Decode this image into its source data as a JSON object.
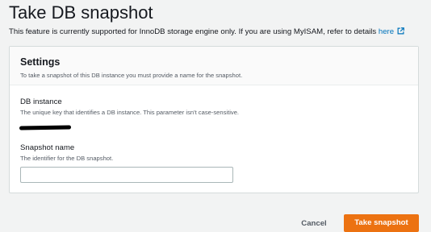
{
  "page": {
    "title": "Take DB snapshot",
    "intro_text": "This feature is currently supported for InnoDB storage engine only. If you are using MyISAM, refer to details ",
    "intro_link": "here",
    "link_icon": "external-link-icon"
  },
  "settings": {
    "title": "Settings",
    "description": "To take a snapshot of this DB instance you must provide a name for the snapshot.",
    "db_instance": {
      "label": "DB instance",
      "description": "The unique key that identifies a DB instance. This parameter isn't case-sensitive.",
      "value_redacted": true
    },
    "snapshot_name": {
      "label": "Snapshot name",
      "description": "The identifier for the DB snapshot.",
      "value": "",
      "placeholder": ""
    }
  },
  "actions": {
    "cancel_label": "Cancel",
    "submit_label": "Take snapshot"
  },
  "colors": {
    "accent": "#ec7211",
    "link": "#0073bb",
    "background": "#f2f3f3"
  }
}
